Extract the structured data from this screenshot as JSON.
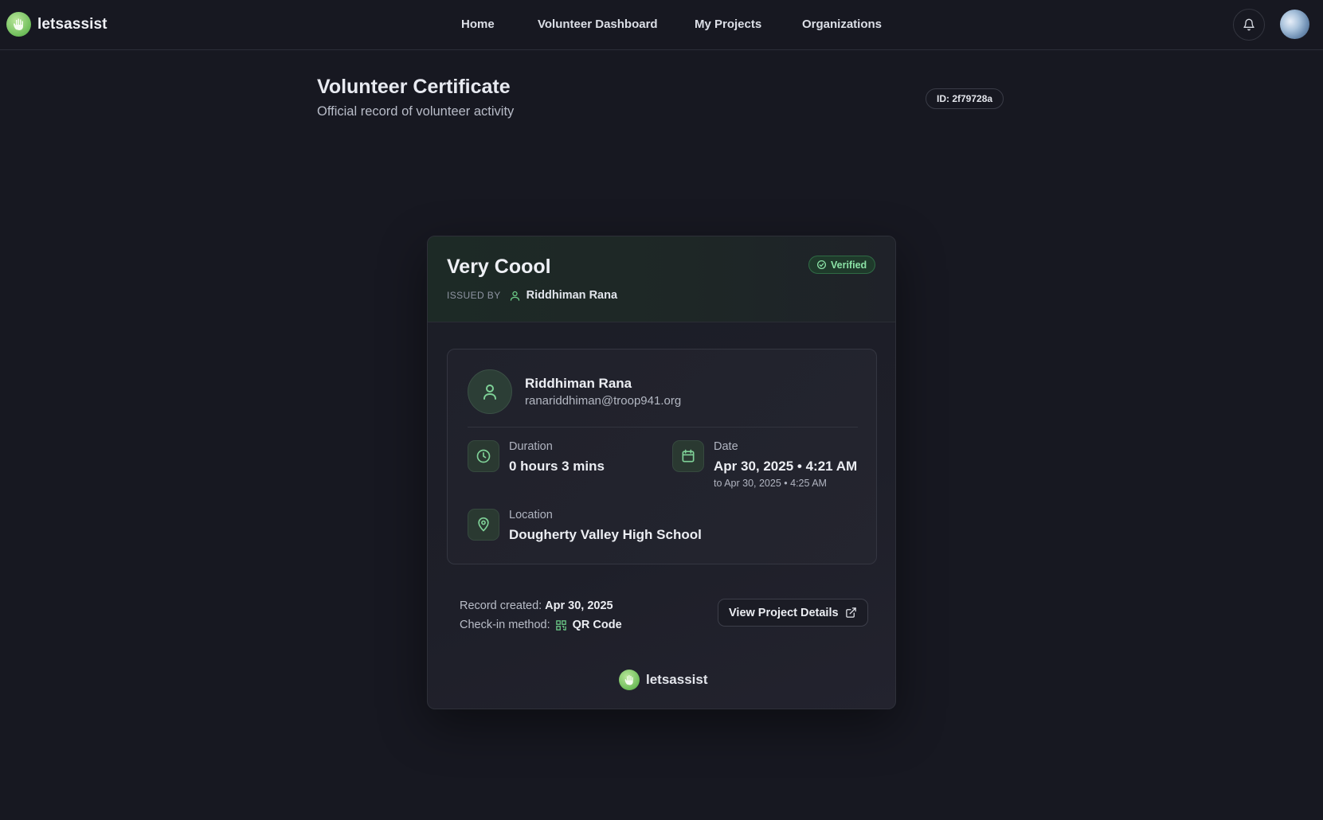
{
  "app": {
    "name": "letsassist"
  },
  "nav": {
    "items": [
      {
        "label": "Home"
      },
      {
        "label": "Volunteer Dashboard"
      },
      {
        "label": "My Projects"
      },
      {
        "label": "Organizations"
      }
    ]
  },
  "icons": {
    "notifications": "bell-icon",
    "logo": "hand-icon"
  },
  "header": {
    "title": "Volunteer Certificate",
    "subtitle": "Official record of volunteer activity",
    "id_badge": "ID: 2f79728a"
  },
  "certificate": {
    "title": "Very Coool",
    "status": "Verified",
    "issued_by_label": "ISSUED BY",
    "issued_by_name": "Riddhiman Rana",
    "volunteer": {
      "name": "Riddhiman Rana",
      "email": "ranariddhiman@troop941.org"
    },
    "duration": {
      "label": "Duration",
      "value": "0 hours 3 mins"
    },
    "date": {
      "label": "Date",
      "value": "Apr 30, 2025 • 4:21 AM",
      "end": "to Apr 30, 2025 • 4:25 AM"
    },
    "location": {
      "label": "Location",
      "value": "Dougherty Valley High School"
    },
    "record_created_label": "Record created:",
    "record_created_value": "Apr 30, 2025",
    "checkin_label": "Check-in method:",
    "checkin_value": "QR Code",
    "view_button": "View Project Details",
    "footer_brand": "letsassist"
  },
  "colors": {
    "background": "#171821",
    "accent_green": "#6ebd5a",
    "verified_text": "#8be2a6"
  }
}
